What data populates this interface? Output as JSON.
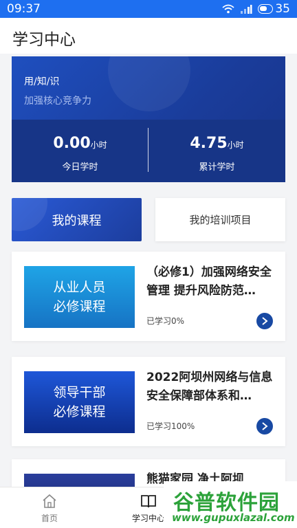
{
  "status_bar": {
    "time": "09:37",
    "battery": "35"
  },
  "header": {
    "title": "学习中心"
  },
  "banner": {
    "slogan": "用/知/识",
    "subslogan": "加强核心竞争力",
    "today": {
      "value": "0.00",
      "unit": "小时",
      "label": "今日学时"
    },
    "total": {
      "value": "4.75",
      "unit": "小时",
      "label": "累计学时"
    }
  },
  "tabs": {
    "active": "我的课程",
    "inactive": "我的培训项目"
  },
  "courses": [
    {
      "thumb_line1": "从业人员",
      "thumb_line2": "必修课程",
      "title": "（必修1）加强网络安全管理 提升风险防范…",
      "progress": "已学习0%"
    },
    {
      "thumb_line1": "领导干部",
      "thumb_line2": "必修课程",
      "title": "2022阿坝州网络与信息安全保障部体系和…",
      "progress": "已学习100%"
    },
    {
      "title": "熊猫家园 净土阿坝"
    }
  ],
  "bottom_nav": {
    "home": "首页",
    "study": "学习中心"
  },
  "watermark": {
    "text": "谷普软件园",
    "url": "www.gupuxlazal.com"
  },
  "colors": {
    "status_bar": "#1e6ff0",
    "banner": "#1a3c9a",
    "accent_button": "#1849a3"
  }
}
